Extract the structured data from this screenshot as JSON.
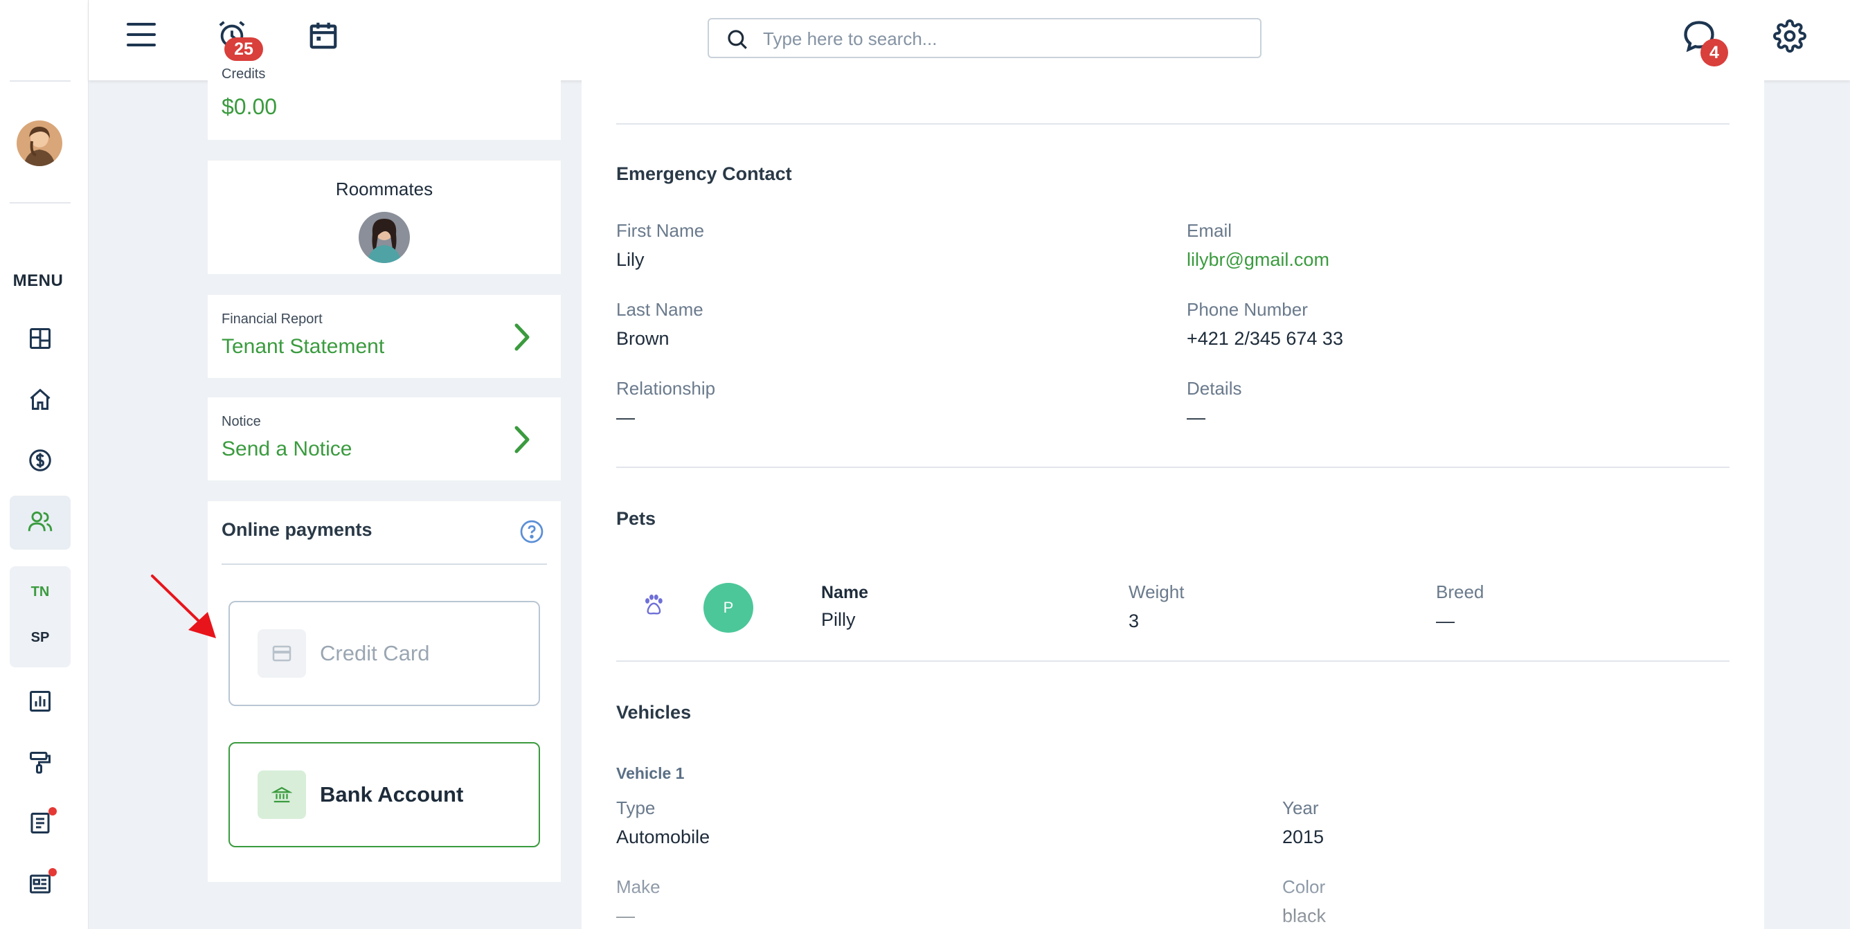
{
  "topbar": {
    "reminders_badge": "25",
    "messages_badge": "4",
    "search_placeholder": "Type here to search..."
  },
  "rail": {
    "menu_label": "MENU",
    "tn_label": "TN",
    "sp_label": "SP"
  },
  "left": {
    "credits_label": "Credits",
    "credits_value": "$0.00",
    "roommates_title": "Roommates",
    "financial_report_label": "Financial Report",
    "financial_report_link": "Tenant Statement",
    "notice_label": "Notice",
    "notice_link": "Send a Notice",
    "online_payments_title": "Online payments",
    "credit_card_label": "Credit Card",
    "bank_account_label": "Bank Account"
  },
  "emergency": {
    "title": "Emergency Contact",
    "first_name_label": "First Name",
    "first_name": "Lily",
    "email_label": "Email",
    "email": "lilybr@gmail.com",
    "last_name_label": "Last Name",
    "last_name": "Brown",
    "phone_label": "Phone Number",
    "phone": "+421 2/345 674 33",
    "relationship_label": "Relationship",
    "relationship": "—",
    "details_label": "Details",
    "details": "—"
  },
  "pets": {
    "title": "Pets",
    "avatar_letter": "P",
    "name_label": "Name",
    "name": "Pilly",
    "weight_label": "Weight",
    "weight": "3",
    "breed_label": "Breed",
    "breed": "—"
  },
  "vehicles": {
    "title": "Vehicles",
    "vehicle_title": "Vehicle 1",
    "type_label": "Type",
    "type": "Automobile",
    "year_label": "Year",
    "year": "2015",
    "make_label": "Make",
    "make": "—",
    "color_label": "Color",
    "color": "black"
  },
  "colors": {
    "accent_green": "#3a9b3e",
    "badge_red": "#d93f3b",
    "pet_avatar": "#4cc79a",
    "annotation_arrow": "#e8141b"
  },
  "icons": [
    "menu-icon",
    "alarm-icon",
    "calendar-icon",
    "search-icon",
    "chat-icon",
    "gear-icon",
    "dashboard-icon",
    "home-icon",
    "dollar-icon",
    "users-icon",
    "chart-icon",
    "paint-roller-icon",
    "document-icon",
    "newspaper-icon",
    "chevron-right-icon",
    "help-icon",
    "credit-card-icon",
    "bank-icon",
    "paw-icon"
  ]
}
